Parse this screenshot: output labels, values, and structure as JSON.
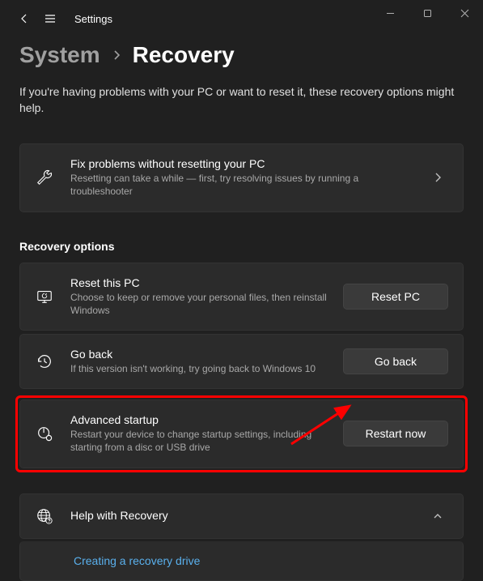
{
  "app": {
    "title": "Settings"
  },
  "breadcrumb": {
    "parent": "System",
    "current": "Recovery"
  },
  "intro": "If you're having problems with your PC or want to reset it, these recovery options might help.",
  "fix": {
    "title": "Fix problems without resetting your PC",
    "desc": "Resetting can take a while — first, try resolving issues by running a troubleshooter"
  },
  "section_label": "Recovery options",
  "reset": {
    "title": "Reset this PC",
    "desc": "Choose to keep or remove your personal files, then reinstall Windows",
    "button": "Reset PC"
  },
  "goback": {
    "title": "Go back",
    "desc": "If this version isn't working, try going back to Windows 10",
    "button": "Go back"
  },
  "advanced": {
    "title": "Advanced startup",
    "desc": "Restart your device to change startup settings, including starting from a disc or USB drive",
    "button": "Restart now"
  },
  "help": {
    "title": "Help with Recovery",
    "link1": "Creating a recovery drive"
  }
}
